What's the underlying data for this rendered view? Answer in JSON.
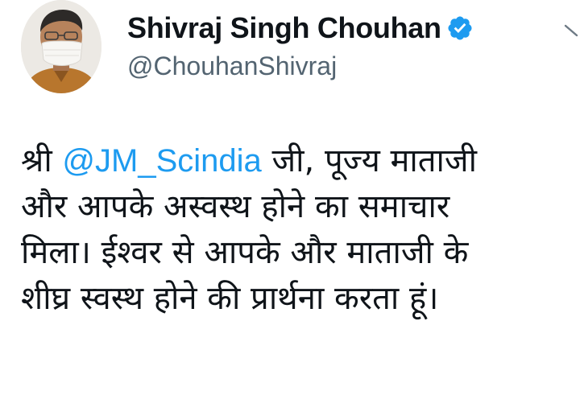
{
  "author": {
    "display_name": "Shivraj Singh Chouhan",
    "handle": "@ChouhanShivraj",
    "verified": true,
    "avatar_icon": "profile-photo-masked",
    "verified_icon": "verified-badge-icon",
    "verified_color": "#1d9bf0"
  },
  "menu": {
    "icon": "chevron-down-icon"
  },
  "tweet": {
    "line1_prefix": "श्री ",
    "mention": "@JM_Scindia",
    "line1_suffix": " जी, पूज्य माताजी",
    "line2": "और आपके अस्वस्थ होने का समाचार",
    "line3": "मिला। ईश्वर से आपके और माताजी के",
    "line4": "शीघ्र स्वस्थ होने की प्रार्थना करता हूं।"
  },
  "colors": {
    "mention": "#1d9bf0",
    "text": "#0f1419",
    "handle": "#536471",
    "background": "#ffffff"
  }
}
